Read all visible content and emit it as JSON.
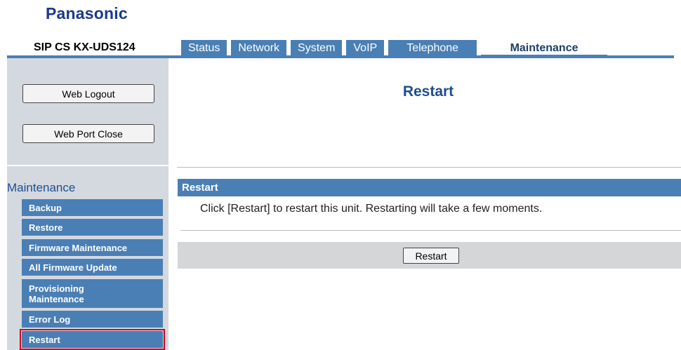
{
  "brand": "Panasonic",
  "model": "SIP CS KX-UDS124",
  "tabs": [
    {
      "label": "Status"
    },
    {
      "label": "Network"
    },
    {
      "label": "System"
    },
    {
      "label": "VoIP"
    },
    {
      "label": "Telephone"
    },
    {
      "label": "Maintenance"
    }
  ],
  "sidebar": {
    "logout_label": "Web Logout",
    "port_close_label": "Web Port Close",
    "section_title": "Maintenance",
    "items": [
      {
        "label": "Backup"
      },
      {
        "label": "Restore"
      },
      {
        "label": "Firmware Maintenance"
      },
      {
        "label": "All Firmware Update"
      },
      {
        "label": "Provisioning Maintenance"
      },
      {
        "label": "Error Log"
      },
      {
        "label": "Restart"
      }
    ]
  },
  "main": {
    "page_title": "Restart",
    "section_title": "Restart",
    "description": "Click [Restart] to restart this unit. Restarting will take a few moments.",
    "restart_button": "Restart"
  },
  "colors": {
    "brand": "#1b3a8c",
    "accent": "#4a7fb5",
    "sidebar_bg": "#d4d8df",
    "highlight": "#d9001b"
  }
}
